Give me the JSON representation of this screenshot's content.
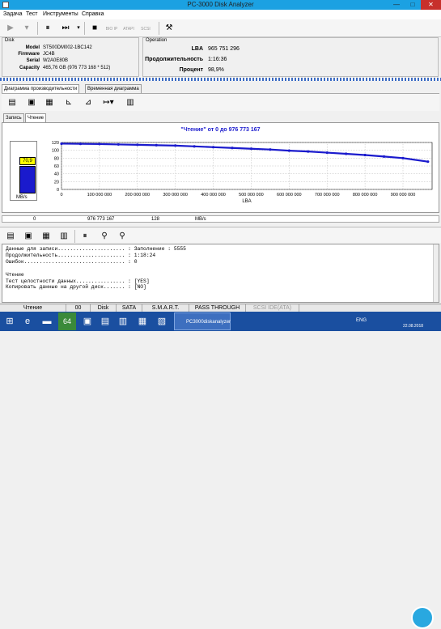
{
  "window": {
    "title": "PC-3000 Disk Analyzer",
    "min": "—",
    "max": "□",
    "close": "✕"
  },
  "menu": [
    "Задача",
    "Тест",
    "Инструменты",
    "Справка"
  ],
  "toolbar": {
    "disabled_labels": [
      "BIO IP",
      "ATAPI",
      "SCSI"
    ]
  },
  "disk": {
    "group": "Disk",
    "fields": [
      {
        "label": "Model",
        "value": "ST500DM002-1BC142"
      },
      {
        "label": "Firmware",
        "value": "JC4B"
      },
      {
        "label": "Serial",
        "value": "W2A0E80B"
      },
      {
        "label": "Capacity",
        "value": "465,76 GB (976 773 168 * 512)"
      }
    ]
  },
  "operation": {
    "group": "Operation",
    "fields": [
      {
        "label": "LBA",
        "value": "965 751 296"
      },
      {
        "label": "Продолжительность",
        "value": "1:16:36"
      },
      {
        "label": "Процент",
        "value": "98,9%"
      }
    ]
  },
  "tabs": {
    "main": [
      "Диаграмма производительности",
      "Временная диаграмма"
    ],
    "sub": [
      "Запись",
      "Чтение"
    ]
  },
  "gauge": {
    "value": "70,9",
    "unit": "MB/s",
    "level": 0.591
  },
  "chart_data": {
    "type": "line",
    "title": "\"Чтение\" от 0 до 976 773 167",
    "xlabel": "LBA",
    "ylabel": "",
    "ylim": [
      0,
      120
    ],
    "yticks": [
      0,
      20,
      40,
      60,
      80,
      100,
      120
    ],
    "xlim": [
      0,
      976773167
    ],
    "xticks": [
      0,
      100000000,
      200000000,
      300000000,
      400000000,
      500000000,
      600000000,
      700000000,
      800000000,
      900000000
    ],
    "xtick_labels": [
      "0",
      "100 000 000",
      "200 000 000",
      "300 000 000",
      "400 000 000",
      "500 000 000",
      "600 000 000",
      "700 000 000",
      "800 000 000",
      "900 000 000"
    ],
    "grid": true,
    "color": "#1a1acd",
    "x": [
      0,
      50000000,
      100000000,
      150000000,
      200000000,
      250000000,
      300000000,
      350000000,
      400000000,
      450000000,
      500000000,
      550000000,
      600000000,
      650000000,
      700000000,
      750000000,
      800000000,
      850000000,
      900000000,
      965751296
    ],
    "y": [
      117,
      116.5,
      116,
      115,
      114,
      113,
      112,
      110,
      108,
      106,
      104,
      102,
      99,
      97,
      94,
      91,
      88,
      84,
      80,
      71
    ]
  },
  "chart_footer": [
    "0",
    "976 773 167",
    "128",
    "MB/s"
  ],
  "log": [
    "Данные для записи...................... : Заполнение : 5555",
    "Продолжительность...................... : 1:18:24",
    "Ошибок................................. : 0",
    "",
    "Чтение",
    "Тест целостности данных................ : [YES]",
    "Копировать данные на другой диск....... : [NO]"
  ],
  "status": [
    "Чтение",
    "00",
    "Disk",
    "SATA",
    "S.M.A.R.T.",
    "PASS THROUGH",
    "SCSI IDE(ATA)"
  ],
  "taskbar": {
    "active_app": "PC3000diskanalyzer",
    "lang": "ENG",
    "date": "22.08.2018",
    "badge": "64"
  }
}
